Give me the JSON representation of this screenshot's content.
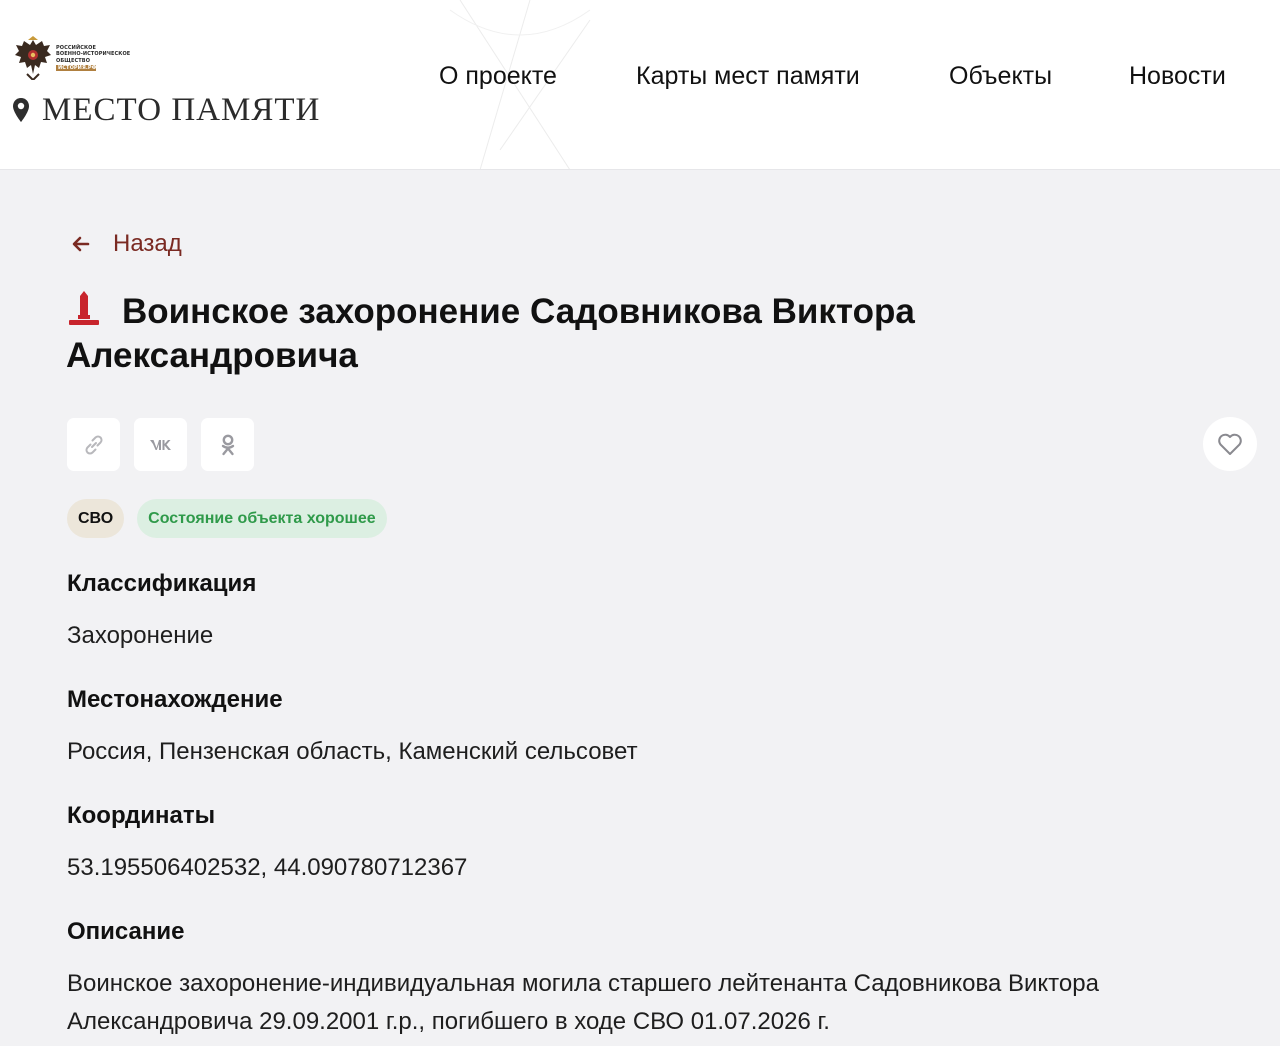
{
  "header": {
    "org_logo": {
      "lines": [
        "РОССИЙСКОЕ",
        "ВОЕННО-ИСТОРИЧЕСКОЕ",
        "ОБЩЕСТВО"
      ],
      "badge": "ИСТОРИЯ.РФ",
      "icon": "double-headed-eagle-icon"
    },
    "site_name": "МЕСТО ПАМЯТИ",
    "site_icon": "map-pin-icon",
    "nav": [
      {
        "label": "О проекте"
      },
      {
        "label": "Карты мест памяти"
      },
      {
        "label": "Объекты"
      },
      {
        "label": "Новости"
      }
    ]
  },
  "back": {
    "label": "Назад",
    "icon": "arrow-left-icon"
  },
  "object": {
    "icon": "grave-marker-icon",
    "title": "Воинское захоронение Садовникова Виктора Александровича",
    "share_icons": [
      "link-icon",
      "vk-icon",
      "odnoklassniki-icon"
    ],
    "favorite_icon": "heart-icon",
    "tags": [
      "СВО",
      "Состояние объекта хорошее"
    ],
    "fields": [
      {
        "label": "Классификация",
        "value": "Захоронение"
      },
      {
        "label": "Местонахождение",
        "value": "Россия, Пензенская область, Каменский сельсовет"
      },
      {
        "label": "Координаты",
        "value": "53.195506402532, 44.090780712367"
      },
      {
        "label": "Описание",
        "value": "Воинское захоронение-индивидуальная могила старшего лейтенанта Садовникова Виктора Александровича 29.09.2001 г.р., погибшего в ходе СВО 01.07.2026 г."
      }
    ]
  },
  "colors": {
    "accent": "#7a2a22",
    "grave_icon": "#c8242c",
    "status_text": "#2f9a4a",
    "status_bg": "#dcefe2",
    "svo_bg": "#ece6da",
    "page_bg": "#f2f2f4"
  }
}
